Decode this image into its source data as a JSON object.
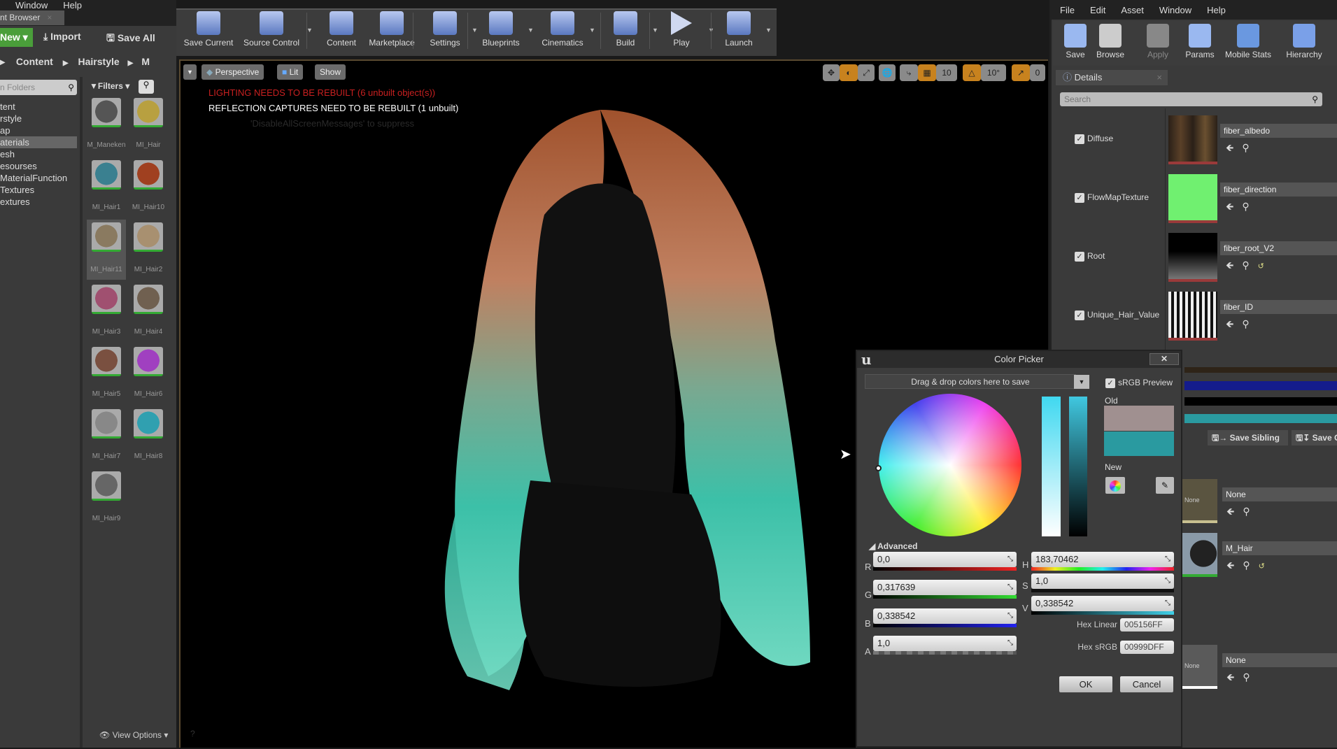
{
  "left": {
    "menu": [
      "Window",
      "Help"
    ],
    "tab": "nt Browser",
    "new": "New",
    "import": "Import",
    "save_all": "Save All",
    "path": [
      "Content",
      "Hairstyle",
      "M"
    ],
    "search_placeholder": "n Folders",
    "filters": "Filters",
    "tree": [
      "tent",
      "rstyle",
      "ap",
      "aterials",
      "esh",
      "esourses",
      "MaterialFunction",
      "Textures",
      "extures"
    ],
    "assets": [
      "M_Maneken",
      "MI_Hair",
      "MI_Hair1",
      "MI_Hair10",
      "MI_Hair11",
      "MI_Hair2",
      "MI_Hair3",
      "MI_Hair4",
      "MI_Hair5",
      "MI_Hair6",
      "MI_Hair7",
      "MI_Hair8",
      "MI_Hair9"
    ],
    "view_options": "View Options"
  },
  "toolbar": [
    "Save Current",
    "Source Control",
    "Content",
    "Marketplace",
    "Settings",
    "Blueprints",
    "Cinematics",
    "Build",
    "Play",
    "Launch"
  ],
  "viewport": {
    "perspective": "Perspective",
    "lit": "Lit",
    "show": "Show",
    "msg_lighting": "LIGHTING NEEDS TO BE REBUILT (6 unbuilt object(s))",
    "msg_reflection": "REFLECTION CAPTURES NEED TO BE REBUILT (1 unbuilt)",
    "msg_suppress": "'DisableAllScreenMessages' to suppress",
    "grid_snap": "10",
    "rot_snap": "10°",
    "scale_snap": "0"
  },
  "right": {
    "menu": [
      "File",
      "Edit",
      "Asset",
      "Window",
      "Help"
    ],
    "toolbar": [
      "Save",
      "Browse",
      "Apply",
      "Params",
      "Mobile Stats",
      "Hierarchy"
    ],
    "details_tab": "Details",
    "search_placeholder": "Search",
    "params": [
      {
        "label": "Diffuse",
        "texture": "fiber_albedo"
      },
      {
        "label": "FlowMapTexture",
        "texture": "fiber_direction"
      },
      {
        "label": "Root",
        "texture": "fiber_root_V2"
      },
      {
        "label": "Unique_Hair_Value",
        "texture": "fiber_ID"
      }
    ],
    "save_sibling": "Save Sibling",
    "save_child": "Save C",
    "lower": [
      {
        "thumb": "None",
        "name": "None"
      },
      {
        "thumb": "",
        "name": "M_Hair"
      },
      {
        "thumb": "None",
        "name": "None"
      }
    ]
  },
  "picker": {
    "title": "Color Picker",
    "drop_hint": "Drag & drop colors here to save",
    "srgb_preview": "sRGB Preview",
    "old": "Old",
    "new": "New",
    "advanced": "Advanced",
    "R": "0,0",
    "G": "0,317639",
    "B": "0,338542",
    "A": "1,0",
    "H": "183,70462",
    "S": "1,0",
    "V": "0,338542",
    "hex_linear_label": "Hex Linear",
    "hex_linear": "005156FF",
    "hex_srgb_label": "Hex sRGB",
    "hex_srgb": "00999DFF",
    "ok": "OK",
    "cancel": "Cancel",
    "old_color": "#a09090",
    "new_color": "#2a9aa0"
  }
}
